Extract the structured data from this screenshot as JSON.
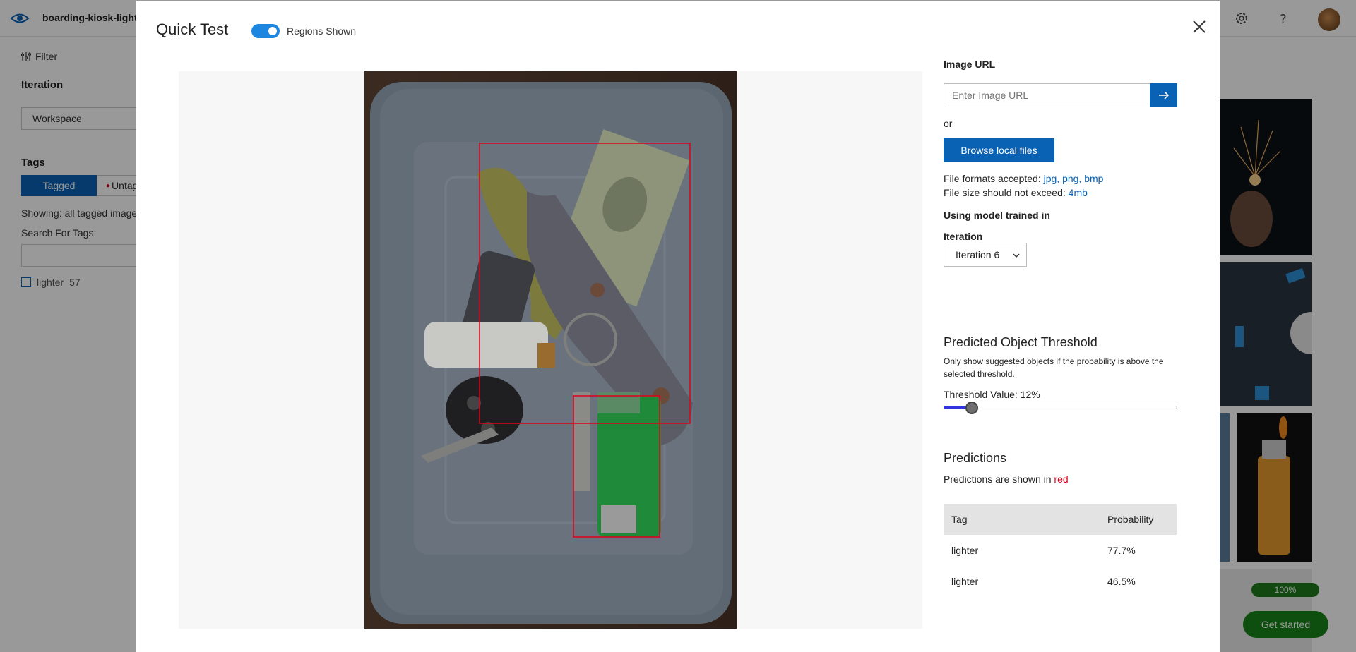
{
  "app": {
    "project_name": "boarding-kiosk-lighter",
    "left": {
      "filter_label": "Filter",
      "iteration_heading": "Iteration",
      "iteration_value": "Workspace",
      "tags_heading": "Tags",
      "tagged_label": "Tagged",
      "untagged_label": "Untag",
      "showing_text": "Showing: all tagged image",
      "search_label": "Search For Tags:",
      "tag_items": [
        {
          "name": "lighter",
          "count": "57"
        }
      ]
    },
    "progress_label": "100%",
    "get_started_label": "Get started"
  },
  "modal": {
    "title": "Quick Test",
    "regions_toggle_label": "Regions Shown",
    "regions_toggle_on": true,
    "image_url_heading": "Image URL",
    "image_url_placeholder": "Enter Image URL",
    "or_text": "or",
    "browse_label": "Browse local files",
    "formats_prefix": "File formats accepted:",
    "formats_value": "jpg, png, bmp",
    "size_prefix": "File size should not exceed:",
    "size_value": "4mb",
    "model_heading": "Using model trained in",
    "iteration_label": "Iteration",
    "iteration_selected": "Iteration 6",
    "threshold_heading": "Predicted Object Threshold",
    "threshold_desc": "Only show suggested objects if the probability is above the selected threshold.",
    "threshold_value_text": "Threshold Value: 12%",
    "threshold_percent": 12,
    "predictions_heading": "Predictions",
    "predictions_note_prefix": "Predictions are shown in",
    "predictions_note_color": "red",
    "table_headers": {
      "tag": "Tag",
      "probability": "Probability"
    },
    "predictions": [
      {
        "tag": "lighter",
        "probability": "77.7%"
      },
      {
        "tag": "lighter",
        "probability": "46.5%"
      }
    ]
  },
  "colors": {
    "accent": "#0a62b5",
    "toggle": "#1d86e0",
    "region": "#e0001b",
    "slider_fill": "#3333e0"
  }
}
